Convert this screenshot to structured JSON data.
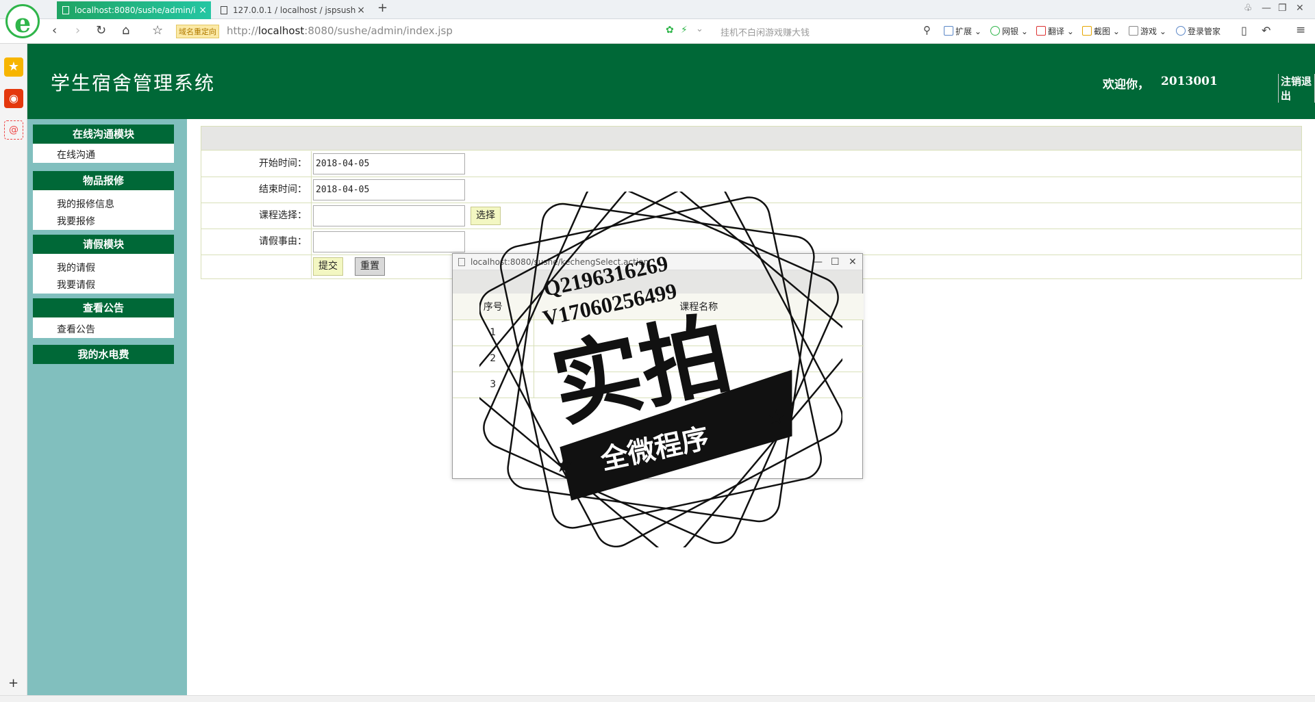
{
  "browser": {
    "tabs": [
      {
        "label": "localhost:8080/sushe/admin/i"
      },
      {
        "label": "127.0.0.1 / localhost / jspsush"
      }
    ],
    "new_tab": "+",
    "redirect_badge": "域名重定向",
    "url_prefix": "http://",
    "url_host": "localhost",
    "url_rest": ":8080/sushe/admin/index.jsp",
    "search_hint": "挂机不白闲游戏赚大钱",
    "toolbar": [
      "扩展",
      "网银",
      "翻译",
      "截图",
      "游戏",
      "登录管家"
    ]
  },
  "header": {
    "title": "学生宿舍管理系统",
    "welcome": "欢迎你，",
    "user": "2013001",
    "logout": "注销退出"
  },
  "menu": {
    "sections": [
      {
        "title": "在线沟通模块",
        "items": [
          "在线沟通"
        ]
      },
      {
        "title": "物品报修",
        "items": [
          "我的报修信息",
          "我要报修"
        ]
      },
      {
        "title": "请假模块",
        "items": [
          "我的请假",
          "我要请假"
        ]
      },
      {
        "title": "查看公告",
        "items": [
          "查看公告"
        ]
      },
      {
        "title": "我的水电费",
        "items": []
      }
    ]
  },
  "form": {
    "start_label": "开始时间：",
    "start_value": "2018-04-05",
    "end_label": "结束时间：",
    "end_value": "2018-04-05",
    "course_label": "课程选择：",
    "course_value": "",
    "select_btn": "选择",
    "reason_label": "请假事由：",
    "reason_value": "",
    "submit_btn": "提交",
    "reset_btn": "重置"
  },
  "popup": {
    "title": "localhost:8080/sushe/kechengSelect.action",
    "col_index": "序号",
    "col_name": "课程名称",
    "rows": [
      {
        "index": "1",
        "name": ""
      },
      {
        "index": "2",
        "name": ""
      },
      {
        "index": "3",
        "name": ""
      }
    ]
  },
  "watermark": {
    "line1": "Q2196316269",
    "line2": "V17060256499",
    "big": "实拍",
    "banner": "全微程序"
  }
}
